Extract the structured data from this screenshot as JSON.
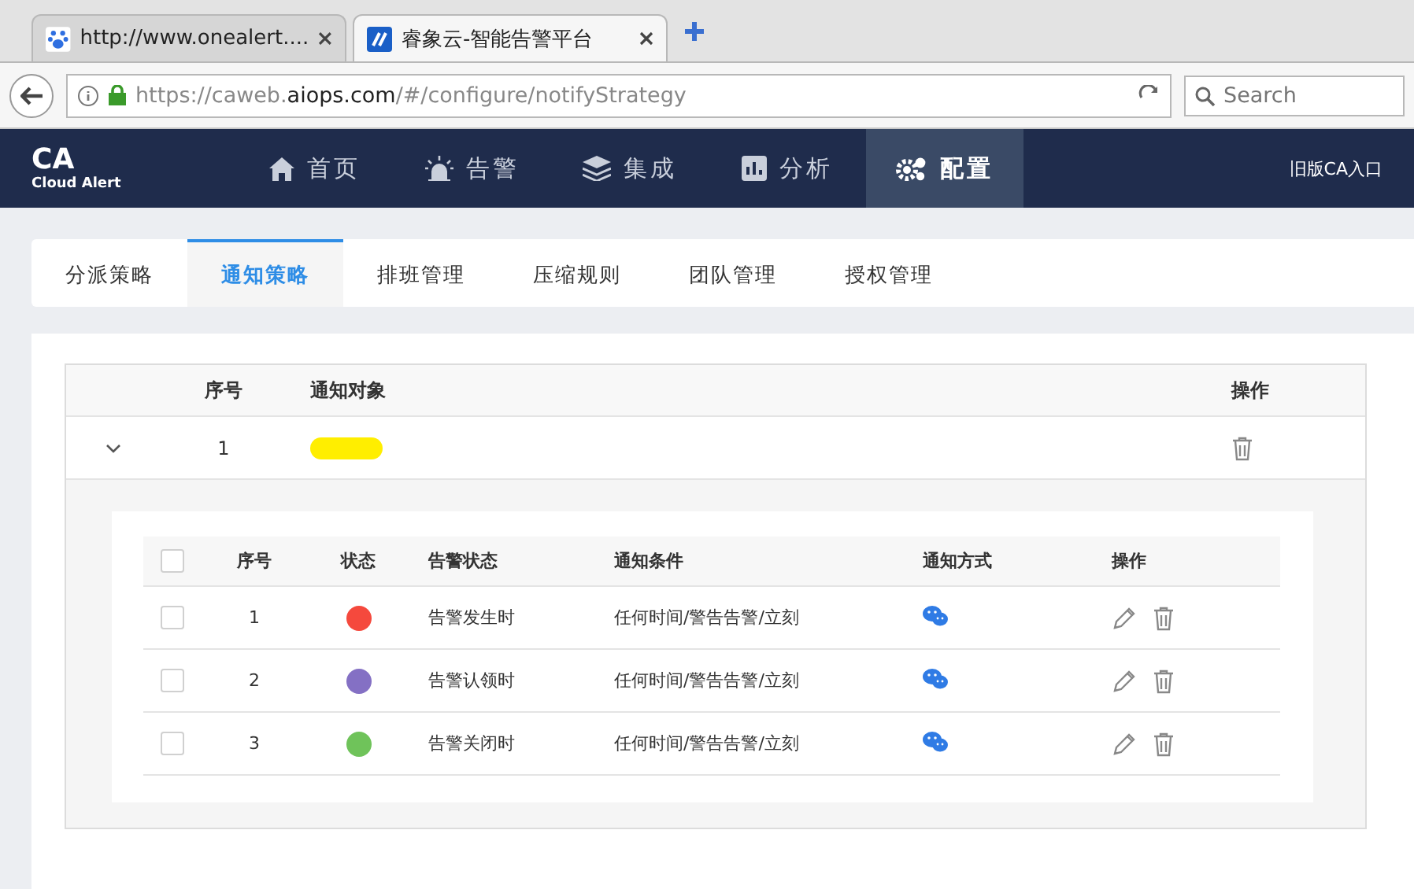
{
  "browser": {
    "tabs": [
      {
        "title": "http://www.onealert....",
        "selected": false
      },
      {
        "title": "睿象云-智能告警平台",
        "selected": true
      }
    ],
    "url": {
      "prefix": "https://caweb.",
      "domain": "aiops.com",
      "path": "/#/configure/notifyStrategy"
    },
    "search": {
      "placeholder": "Search"
    }
  },
  "nav": {
    "logo": {
      "title": "CA",
      "subtitle": "Cloud Alert"
    },
    "items": [
      {
        "label": "首页",
        "selected": false
      },
      {
        "label": "告警",
        "selected": false
      },
      {
        "label": "集成",
        "selected": false
      },
      {
        "label": "分析",
        "selected": false
      },
      {
        "label": "配置",
        "selected": true
      }
    ],
    "legacy_link": "旧版CA入口"
  },
  "subtabs": [
    {
      "label": "分派策略",
      "selected": false
    },
    {
      "label": "通知策略",
      "selected": true
    },
    {
      "label": "排班管理",
      "selected": false
    },
    {
      "label": "压缩规则",
      "selected": false
    },
    {
      "label": "团队管理",
      "selected": false
    },
    {
      "label": "授权管理",
      "selected": false
    }
  ],
  "table": {
    "columns": [
      "序号",
      "通知对象",
      "操作"
    ],
    "rows": [
      {
        "index": "1",
        "expanded": true,
        "detail": {
          "all_checked": false,
          "columns": [
            "序号",
            "状态",
            "告警状态",
            "通知条件",
            "通知方式",
            "操作"
          ],
          "rows": [
            {
              "index": "1",
              "color": "#f5493d",
              "alert_state": "告警发生时",
              "condition": "任何时间/警告告警/立刻",
              "checked": false
            },
            {
              "index": "2",
              "color": "#8470c4",
              "alert_state": "告警认领时",
              "condition": "任何时间/警告告警/立刻",
              "checked": false
            },
            {
              "index": "3",
              "color": "#6fc35a",
              "alert_state": "告警关闭时",
              "condition": "任何时间/警告告警/立刻",
              "checked": false
            }
          ]
        }
      }
    ]
  }
}
